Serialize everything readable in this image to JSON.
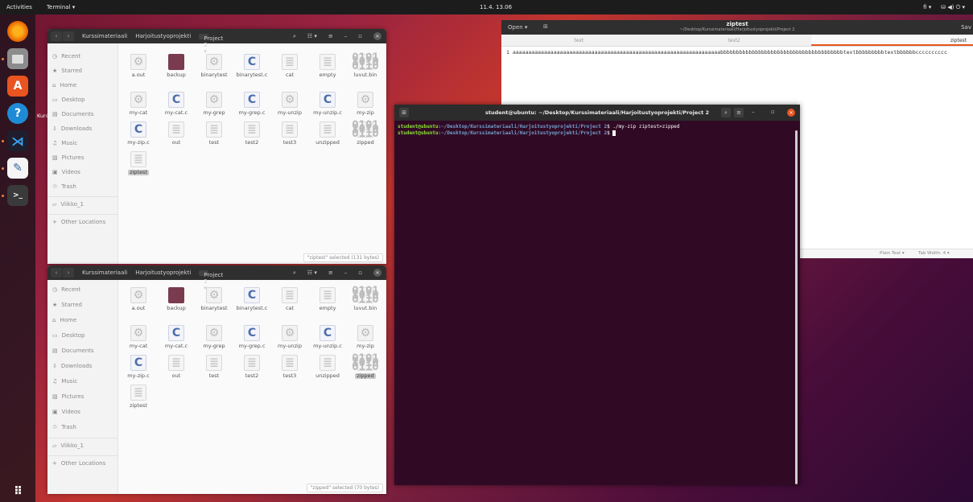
{
  "topbar": {
    "activities": "Activities",
    "app_menu": "Terminal ▾",
    "clock": "11.4. 13.06",
    "lang": "fi ▾",
    "tray": "⛁ ◀) ⏻ ▾"
  },
  "dock": {
    "items": [
      "Firefox",
      "Files",
      "Ubuntu Software",
      "Help",
      "VS Code",
      "Text Editor",
      "Terminal",
      "Show Applications"
    ]
  },
  "desktop_label": "Kurs",
  "filemanager_top": {
    "breadcrumbs": [
      "Kurssimateriaali",
      "Harjoitustyoprojekti",
      "Project 2 ▾"
    ],
    "sidebar": [
      "Recent",
      "Starred",
      "Home",
      "Desktop",
      "Documents",
      "Downloads",
      "Music",
      "Pictures",
      "Videos",
      "Trash",
      "Viikko_1",
      "Other Locations"
    ],
    "files": [
      "a.out",
      "backup",
      "binarytest",
      "binarytest.c",
      "cat",
      "empty",
      "luvut.bin",
      "my-cat",
      "my-cat.c",
      "my-grep",
      "my-grep.c",
      "my-unzip",
      "my-unzip.c",
      "my-zip",
      "my-zip.c",
      "out",
      "test",
      "test2",
      "test3",
      "unzipped",
      "zipped",
      "ziptest"
    ],
    "status": "\"ziptest\" selected (131 bytes)"
  },
  "filemanager_bottom": {
    "breadcrumbs": [
      "Kurssimateriaali",
      "Harjoitustyoprojekti",
      "Project 2 ▾"
    ],
    "sidebar": [
      "Recent",
      "Starred",
      "Home",
      "Desktop",
      "Documents",
      "Downloads",
      "Music",
      "Pictures",
      "Videos",
      "Trash",
      "Viikko_1",
      "Other Locations"
    ],
    "files": [
      "a.out",
      "backup",
      "binarytest",
      "binarytest.c",
      "cat",
      "empty",
      "luvut.bin",
      "my-cat",
      "my-cat.c",
      "my-grep",
      "my-grep.c",
      "my-unzip",
      "my-unzip.c",
      "my-zip",
      "my-zip.c",
      "out",
      "test",
      "test2",
      "test3",
      "unzipped",
      "zipped",
      "ziptest"
    ],
    "status": "\"zipped\" selected (70 bytes)"
  },
  "gedit": {
    "open_label": "Open ▾",
    "title": "ziptest",
    "path": "~/Desktop/Kurssimateriaali/Harjoitustyoprojekti/Project 2",
    "save_label": "Sav",
    "tabs": [
      "text",
      "test2",
      "ziptest"
    ],
    "line": "1 aaaaaaaaaaaaaaaaaaaaaaaaaaaaaaaaaaaaaaaaaaaaaaaaaaaaaaaaaaaaaaaaaabbbbbbbbbbbbbbbbbbbbbbbbbbbbbbbbbbbbbbbtextbbbbbbbbbtextbbbbbbcccccccccc",
    "lang": "Plain Text ▾",
    "tabwidth": "Tab Width: 4 ▾"
  },
  "terminal": {
    "title": "student@ubuntu: ~/Desktop/Kurssimateriaali/Harjoitustyoprojekti/Project 2",
    "prompt_user": "student@ubuntu",
    "prompt_path": ":~/Desktop/Kurssimateriaali/Harjoitustyoprojekti/Project 2",
    "line1_cmd": "$ ./my-zip ziptest>zipped",
    "line2_cmd": "$ "
  }
}
